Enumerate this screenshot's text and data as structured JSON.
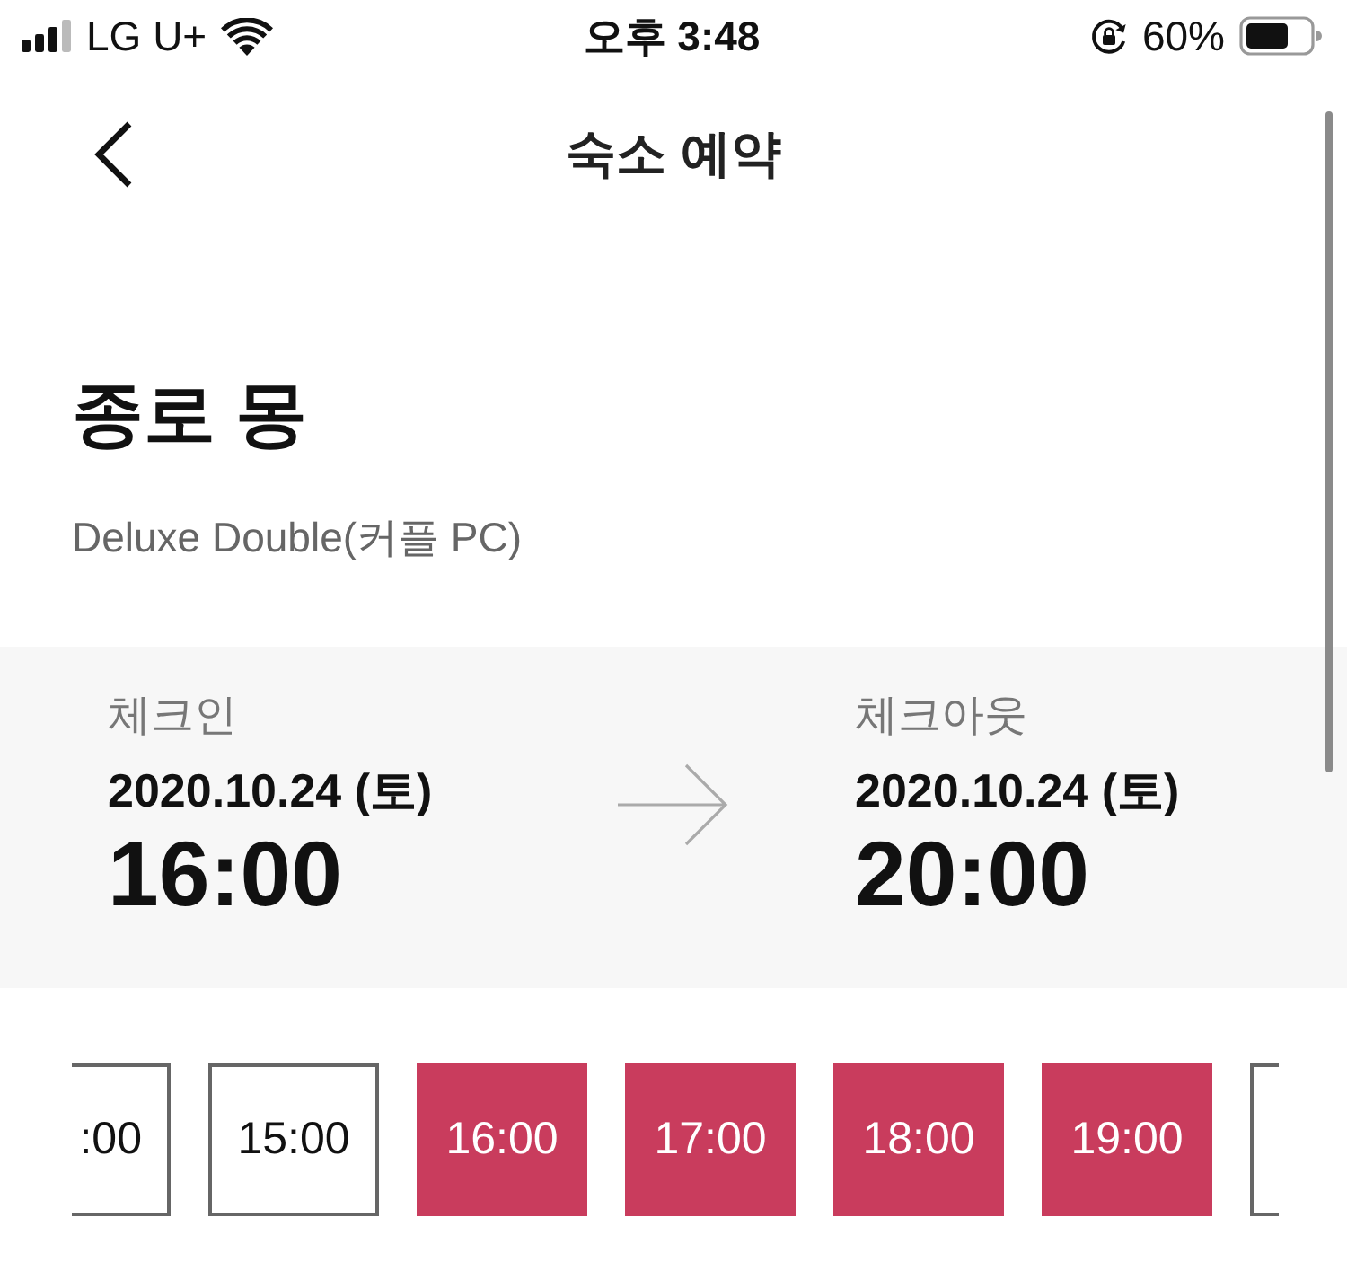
{
  "status_bar": {
    "carrier": "LG U+",
    "time": "오후 3:48",
    "battery": "60%"
  },
  "nav": {
    "title": "숙소 예약"
  },
  "property": {
    "name": "종로 몽",
    "room": "Deluxe Double(커플 PC)"
  },
  "stay": {
    "check_in": {
      "label": "체크인",
      "date": "2020.10.24 (토)",
      "time": "16:00"
    },
    "check_out": {
      "label": "체크아웃",
      "date": "2020.10.24 (토)",
      "time": "20:00"
    }
  },
  "time_slots": [
    {
      "kind": "left-edge",
      "label": ":00",
      "selected": false
    },
    {
      "kind": "full",
      "label": "15:00",
      "selected": false
    },
    {
      "kind": "full",
      "label": "16:00",
      "selected": true
    },
    {
      "kind": "full",
      "label": "17:00",
      "selected": true
    },
    {
      "kind": "full",
      "label": "18:00",
      "selected": true
    },
    {
      "kind": "full",
      "label": "19:00",
      "selected": true
    },
    {
      "kind": "right-edge",
      "selected": false
    }
  ]
}
